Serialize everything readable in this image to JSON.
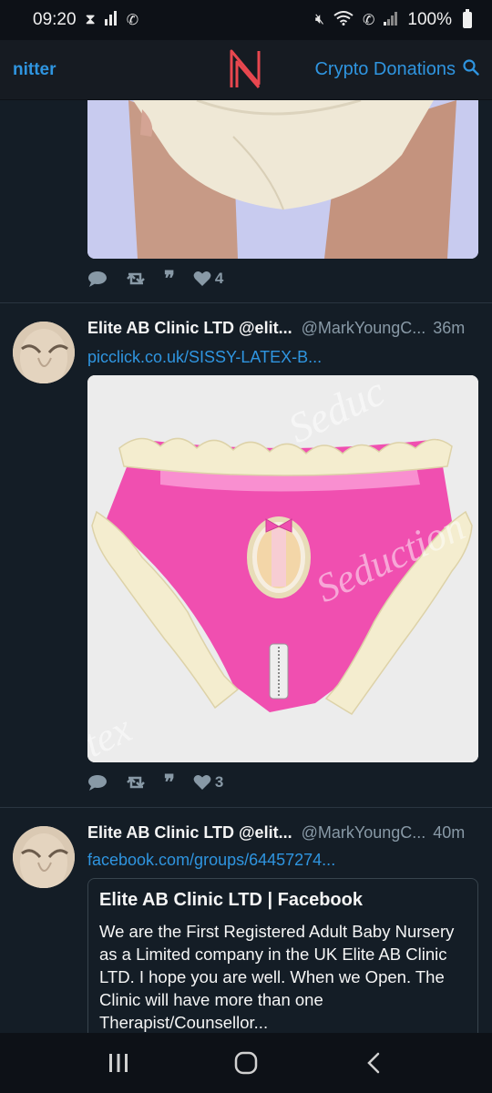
{
  "status_bar": {
    "time": "09:20",
    "battery": "100%"
  },
  "nav": {
    "brand": "nitter",
    "logo_letter": "N",
    "right_link": "Crypto Donations",
    "accent_color": "#2f95e0",
    "logo_color": "#e8474f"
  },
  "tweets": [
    {
      "stats": {
        "likes": "4"
      }
    },
    {
      "name": "Elite AB Clinic LTD @elit...",
      "handle": "@MarkYoungC...",
      "time": "36m",
      "link": "picclick.co.uk/SISSY-LATEX-B...",
      "stats": {
        "likes": "3"
      }
    },
    {
      "name": "Elite AB Clinic LTD @elit...",
      "handle": "@MarkYoungC...",
      "time": "40m",
      "link": "facebook.com/groups/64457274...",
      "card": {
        "title": "Elite AB Clinic LTD | Facebook",
        "description": "We are the First Registered Adult Baby Nursery as a Limited company in the UK Elite AB Clinic LTD. I hope you are well. When we Open. The Clinic will have more than one Therapist/Counsellor..."
      }
    }
  ]
}
